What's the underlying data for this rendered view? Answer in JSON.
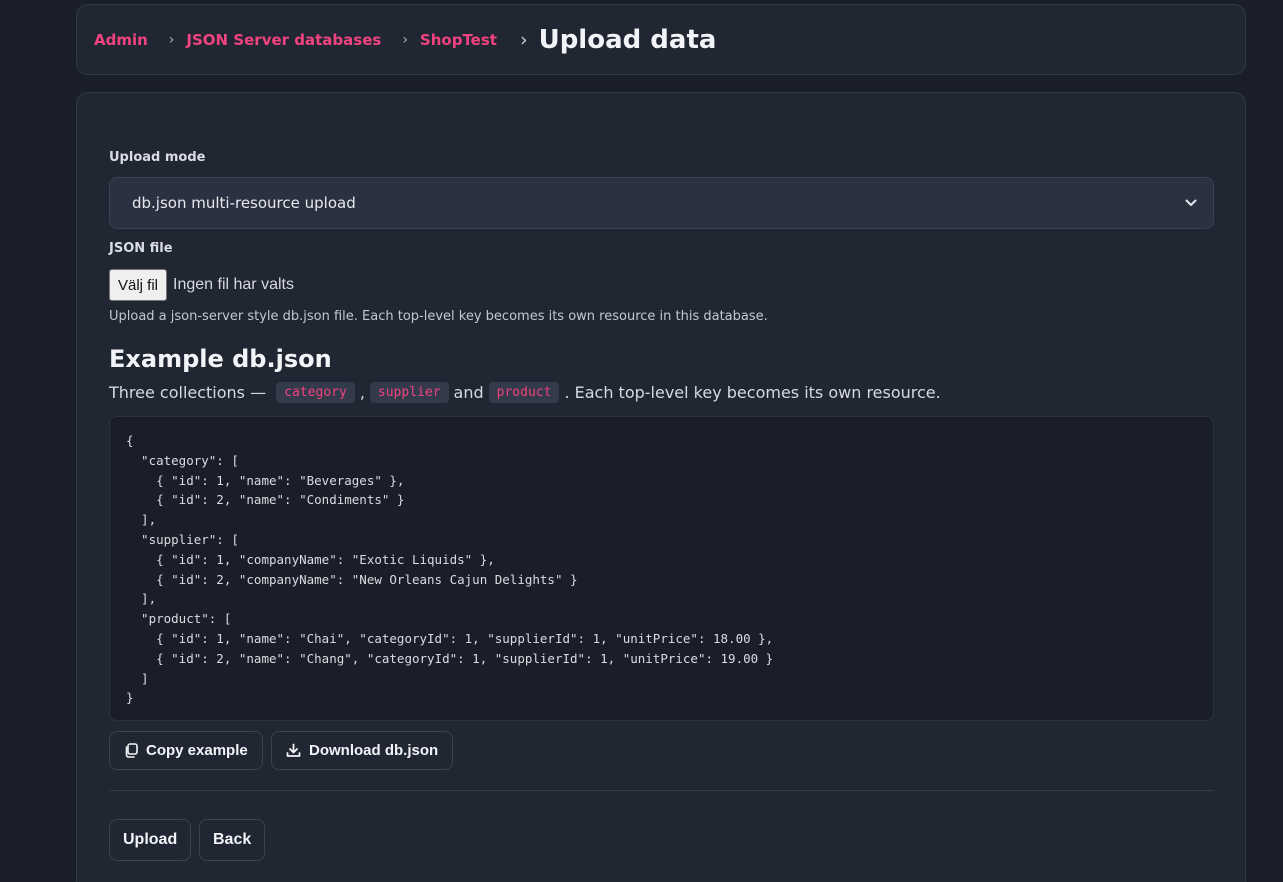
{
  "breadcrumb": {
    "items": [
      "Admin",
      "JSON Server databases",
      "ShopTest"
    ],
    "current": "Upload data"
  },
  "form": {
    "upload_mode_label": "Upload mode",
    "upload_mode_value": "db.json multi-resource upload",
    "json_file_label": "JSON file",
    "file_button": "Välj fil",
    "file_status": "Ingen fil har valts",
    "help_text": "Upload a json-server style db.json file. Each top-level key becomes its own resource in this database."
  },
  "example": {
    "title": "Example db.json",
    "desc_prefix": "Three collections — ",
    "chips": [
      "category",
      "supplier",
      "product"
    ],
    "desc_comma": ",",
    "desc_and": "and",
    "desc_suffix": ". Each top-level key becomes its own resource.",
    "code": "{\n  \"category\": [\n    { \"id\": 1, \"name\": \"Beverages\" },\n    { \"id\": 2, \"name\": \"Condiments\" }\n  ],\n  \"supplier\": [\n    { \"id\": 1, \"companyName\": \"Exotic Liquids\" },\n    { \"id\": 2, \"companyName\": \"New Orleans Cajun Delights\" }\n  ],\n  \"product\": [\n    { \"id\": 1, \"name\": \"Chai\", \"categoryId\": 1, \"supplierId\": 1, \"unitPrice\": 18.00 },\n    { \"id\": 2, \"name\": \"Chang\", \"categoryId\": 1, \"supplierId\": 1, \"unitPrice\": 19.00 }\n  ]\n}",
    "copy_button": "Copy example",
    "download_button": "Download db.json"
  },
  "actions": {
    "upload": "Upload",
    "back": "Back"
  },
  "colors": {
    "accent": "#f0437f",
    "background": "#1a1e29",
    "card": "#212633"
  },
  "icons": {
    "copy": "copy-icon",
    "download": "download-icon",
    "breadcrumb_separator": "chevron-right-icon",
    "select": "chevron-down-icon"
  }
}
